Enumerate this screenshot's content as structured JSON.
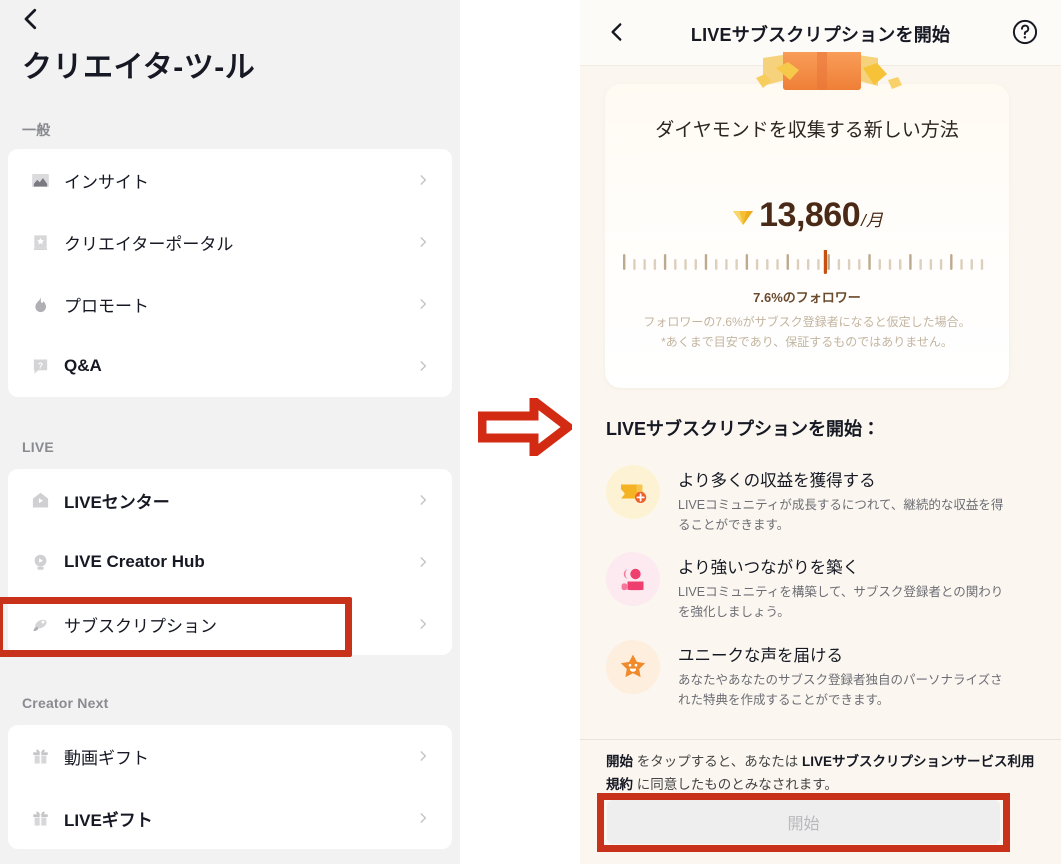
{
  "left_panel": {
    "back_icon": "chevron-left-icon",
    "title": "クリエイタ-ツ-ル",
    "sections": [
      {
        "label": "一般",
        "items": [
          {
            "icon": "chart-icon",
            "label": "インサイト",
            "bold": false
          },
          {
            "icon": "book-star-icon",
            "label": "クリエイターポータル",
            "bold": false
          },
          {
            "icon": "flame-icon",
            "label": "プロモート",
            "bold": false
          },
          {
            "icon": "question-bubble-icon",
            "label": "Q&A",
            "bold": true
          }
        ]
      },
      {
        "label": "LIVE",
        "items": [
          {
            "icon": "home-play-icon",
            "label": "LIVEセンター",
            "bold": true
          },
          {
            "icon": "bulb-play-icon",
            "label": "LIVE Creator Hub",
            "bold": true
          },
          {
            "icon": "rocket-icon",
            "label": "サブスクリプション",
            "bold": false
          }
        ]
      },
      {
        "label": "Creator Next",
        "items": [
          {
            "icon": "gift-icon",
            "label": "動画ギフト",
            "bold": false
          },
          {
            "icon": "gift-icon",
            "label": "LIVEギフト",
            "bold": true
          }
        ]
      }
    ],
    "highlight_color": "#c8321b",
    "highlighted_item": "サブスクリプション"
  },
  "transition": {
    "arrow_icon": "arrow-right-icon",
    "arrow_color": "#d32b13"
  },
  "right_panel": {
    "header": {
      "back_icon": "chevron-left-icon",
      "title": "LIVEサブスクリプションを開始",
      "help_icon": "question-circle-icon"
    },
    "hero": {
      "art_icon": "treasure-chest-icon",
      "title": "ダイヤモンドを収集する新しい方法",
      "currency_icon": "diamond-icon",
      "price_value": "13,860",
      "price_unit": "/月",
      "slider_label": "7.6%のフォロワー",
      "disclaimer": "フォロワーの7.6%がサブスク登録者になると仮定した場合。\n*あくまで目安であり、保証するものではありません。",
      "slider_position_percent": 55
    },
    "features_heading": "LIVEサブスクリプションを開始：",
    "features": [
      {
        "icon": "wallet-plus-icon",
        "badge_color": "#fdf3d4",
        "icon_color": "#f5b324",
        "title": "より多くの収益を獲得する",
        "desc": "LIVEコミュニティが成長するにつれて、継続的な収益を得ることができます。"
      },
      {
        "icon": "people-icon",
        "badge_color": "#fdeaf0",
        "icon_color": "#ef3f6e",
        "title": "より強いつながりを築く",
        "desc": "LIVEコミュニティを構築して、サブスク登録者との関わりを強化しましょう。"
      },
      {
        "icon": "smiling-star-icon",
        "badge_color": "#fdeede",
        "icon_color": "#f08a2a",
        "title": "ユニークな声を届ける",
        "desc": "あなたやあなたのサブスク登録者独自のパーソナライズされた特典を作成することができます。"
      }
    ],
    "footer": {
      "terms_prefix_bold": "開始",
      "terms_mid": " をタップすると、あなたは ",
      "terms_link_bold": "LIVEサブスクリプションサービス利用規約",
      "terms_suffix": " に同意したものとみなされます。",
      "start_button_label": "開始",
      "start_button_enabled": false,
      "highlight_color": "#c8321b"
    }
  }
}
